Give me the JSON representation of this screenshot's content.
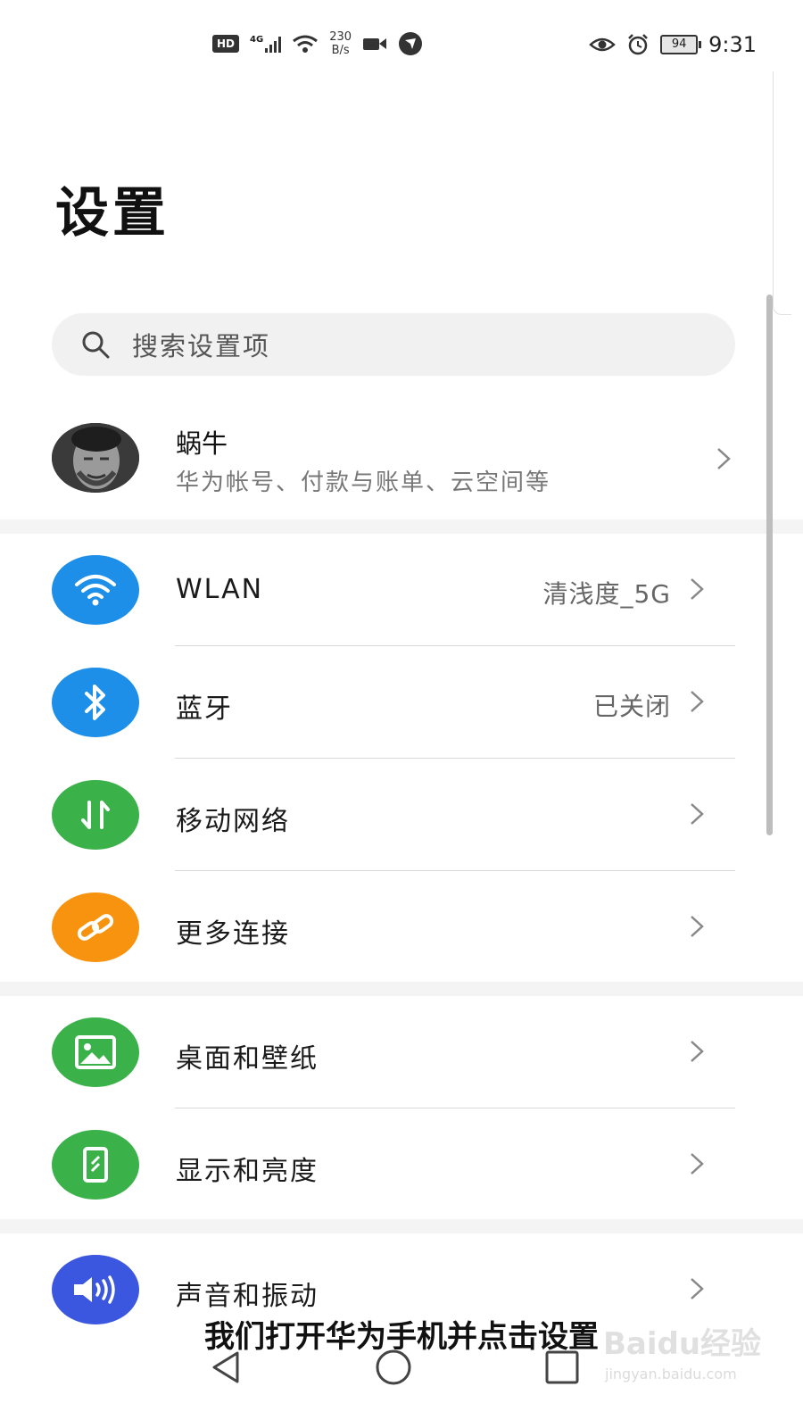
{
  "status_bar": {
    "hd_label": "HD",
    "network_type": "4G",
    "speed_value": "230",
    "speed_unit": "B/s",
    "battery": "94",
    "time": "9:31",
    "icons": [
      "hd-icon",
      "signal-icon",
      "wifi-icon",
      "video-icon",
      "app-notification-icon",
      "eye-icon",
      "alarm-icon",
      "battery-icon"
    ]
  },
  "page": {
    "title": "设置"
  },
  "search": {
    "placeholder": "搜索设置项"
  },
  "account": {
    "name": "蜗牛",
    "subtitle": "华为帐号、付款与账单、云空间等"
  },
  "groups": [
    {
      "items": [
        {
          "label": "WLAN",
          "value": "清浅度_5G",
          "icon": "wifi-icon",
          "color": "#1d8fe8"
        },
        {
          "label": "蓝牙",
          "value": "已关闭",
          "icon": "bluetooth-icon",
          "color": "#1d8fe8"
        },
        {
          "label": "移动网络",
          "value": "",
          "icon": "mobile-data-icon",
          "color": "#3bb14a"
        },
        {
          "label": "更多连接",
          "value": "",
          "icon": "link-icon",
          "color": "#f7930e"
        }
      ]
    },
    {
      "items": [
        {
          "label": "桌面和壁纸",
          "value": "",
          "icon": "wallpaper-icon",
          "color": "#3bb14a"
        },
        {
          "label": "显示和亮度",
          "value": "",
          "icon": "display-icon",
          "color": "#3bb14a"
        }
      ]
    },
    {
      "items": [
        {
          "label": "声音和振动",
          "value": "",
          "icon": "sound-icon",
          "color": "#3b57e0"
        }
      ]
    }
  ],
  "caption": "我们打开华为手机并点击设置",
  "watermark": {
    "main": "Baidu经验",
    "sub": "jingyan.baidu.com"
  },
  "nav": [
    "back-icon",
    "home-icon",
    "recents-icon"
  ]
}
